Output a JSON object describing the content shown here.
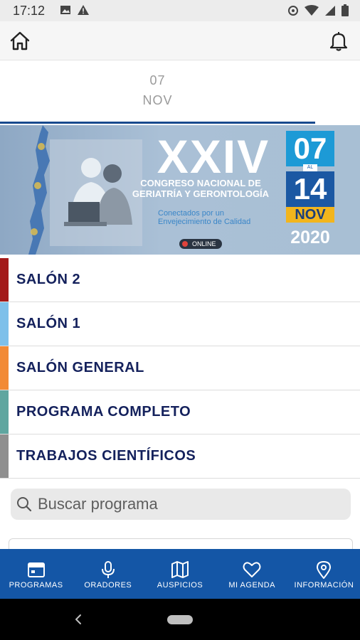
{
  "status_bar": {
    "time": "17:12",
    "left_icons": [
      "image-icon",
      "warning-icon"
    ],
    "right_icons": [
      "data-saver-icon",
      "wifi-icon",
      "signal-icon",
      "battery-icon"
    ]
  },
  "app_bar": {
    "left_icon": "home-icon",
    "right_icon": "bell-icon"
  },
  "date_tab": {
    "day": "07",
    "month": "NOV"
  },
  "banner": {
    "roman": "XXIV",
    "line1": "CONGRESO NACIONAL DE",
    "line2": "GERIATRÍA Y GERONTOLOGÍA",
    "slogan": "Conectados por un Envejecimiento de Calidad",
    "online": "ONLINE",
    "date_from": "07",
    "date_connector": "AL",
    "date_to": "14",
    "month": "NOV",
    "year": "2020"
  },
  "rooms": [
    {
      "label": "SALÓN 2",
      "color": "#a31a1a"
    },
    {
      "label": "SALÓN 1",
      "color": "#7ec0ea"
    },
    {
      "label": "SALÓN GENERAL",
      "color": "#f28a36"
    },
    {
      "label": "PROGRAMA COMPLETO",
      "color": "#5fa6a0"
    },
    {
      "label": "TRABAJOS CIENTÍFICOS",
      "color": "#8f8f8f"
    }
  ],
  "search": {
    "placeholder": "Buscar programa",
    "icon": "search-icon"
  },
  "bottom_nav": [
    {
      "label": "PROGRAMAS",
      "icon": "calendar-icon"
    },
    {
      "label": "ORADORES",
      "icon": "microphone-icon"
    },
    {
      "label": "AUSPICIOS",
      "icon": "map-icon"
    },
    {
      "label": "MI AGENDA",
      "icon": "heart-icon"
    },
    {
      "label": "INFORMACIÓN",
      "icon": "location-pin-icon"
    }
  ],
  "colors": {
    "nav_bg": "#1456a6",
    "room_text": "#14215c",
    "tab_underline": "#184a8e"
  }
}
